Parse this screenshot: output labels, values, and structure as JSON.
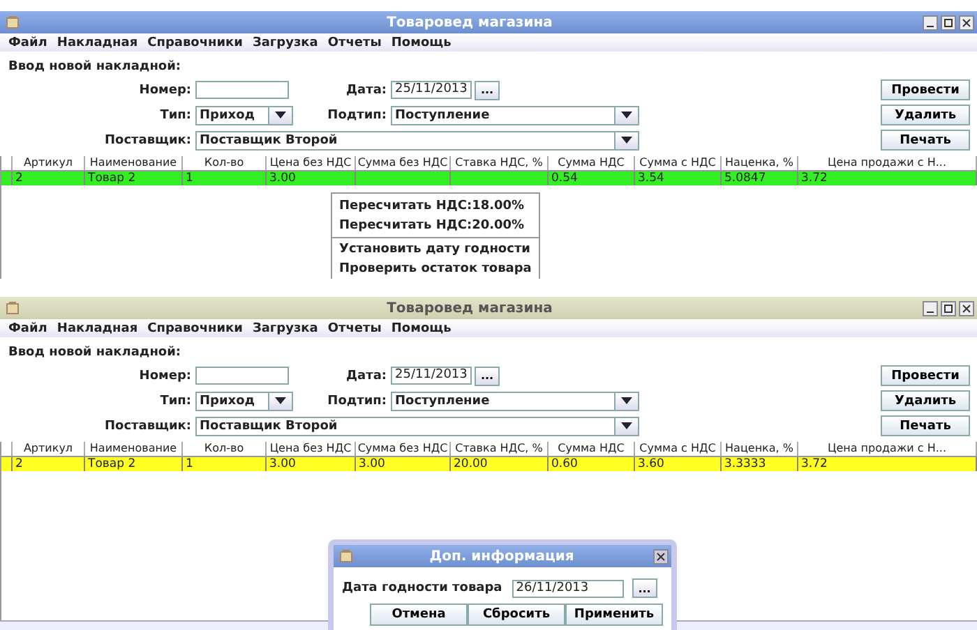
{
  "windows": [
    {
      "active": true,
      "title": "Товаровед магазина",
      "menu": [
        "Файл",
        "Накладная",
        "Справочники",
        "Загрузка",
        "Отчеты",
        "Помощь"
      ],
      "heading": "Ввод новой накладной:",
      "number": {
        "label": "Номер:"
      },
      "date": {
        "label": "Дата:",
        "value": "25/11/2013",
        "button": "..."
      },
      "type": {
        "label": "Тип:",
        "value": "Приход"
      },
      "subtype": {
        "label": "Подтип:",
        "value": "Поступление"
      },
      "supplier": {
        "label": "Поставщик:",
        "value": "Поставщик Второй"
      },
      "buttons": [
        "Провести",
        "Удалить",
        "Печать"
      ],
      "table": {
        "columns": [
          "Артикул",
          "Наименование",
          "Кол-во",
          "Цена без НДС",
          "Сумма без НДС",
          "Ставка НДС, %",
          "Сумма НДС",
          "Сумма с НДС",
          "Наценка, %",
          "Цена продажи с Н..."
        ],
        "rows": [
          {
            "color": "#33ee22",
            "cells": [
              "2",
              "Товар 2",
              "1",
              "3.00",
              "",
              "",
              "0.54",
              "3.54",
              "5.0847",
              "3.72"
            ]
          }
        ]
      },
      "context_menu": {
        "groups": [
          [
            "Пересчитать НДС:18.00%",
            "Пересчитать НДС:20.00%"
          ],
          [
            "Установить дату годности",
            "Проверить остаток товара"
          ]
        ]
      }
    },
    {
      "active": false,
      "title": "Товаровед магазина",
      "menu": [
        "Файл",
        "Накладная",
        "Справочники",
        "Загрузка",
        "Отчеты",
        "Помощь"
      ],
      "heading": "Ввод новой накладной:",
      "number": {
        "label": "Номер:"
      },
      "date": {
        "label": "Дата:",
        "value": "25/11/2013",
        "button": "..."
      },
      "type": {
        "label": "Тип:",
        "value": "Приход"
      },
      "subtype": {
        "label": "Подтип:",
        "value": "Поступление"
      },
      "supplier": {
        "label": "Поставщик:",
        "value": "Поставщик Второй"
      },
      "buttons": [
        "Провести",
        "Удалить",
        "Печать"
      ],
      "table": {
        "columns": [
          "Артикул",
          "Наименование",
          "Кол-во",
          "Цена без НДС",
          "Сумма без НДС",
          "Ставка НДС, %",
          "Сумма НДС",
          "Сумма с НДС",
          "Наценка, %",
          "Цена продажи с Н..."
        ],
        "rows": [
          {
            "color": "#ffff22",
            "cells": [
              "2",
              "Товар 2",
              "1",
              "3.00",
              "3.00",
              "20.00",
              "0.60",
              "3.60",
              "3.3333",
              "3.72"
            ]
          }
        ]
      },
      "dialog": {
        "title": "Доп. информация",
        "label": "Дата годности товара",
        "value": "26/11/2013",
        "button": "...",
        "buttons": [
          "Отмена",
          "Сбросить",
          "Применить"
        ]
      }
    }
  ]
}
